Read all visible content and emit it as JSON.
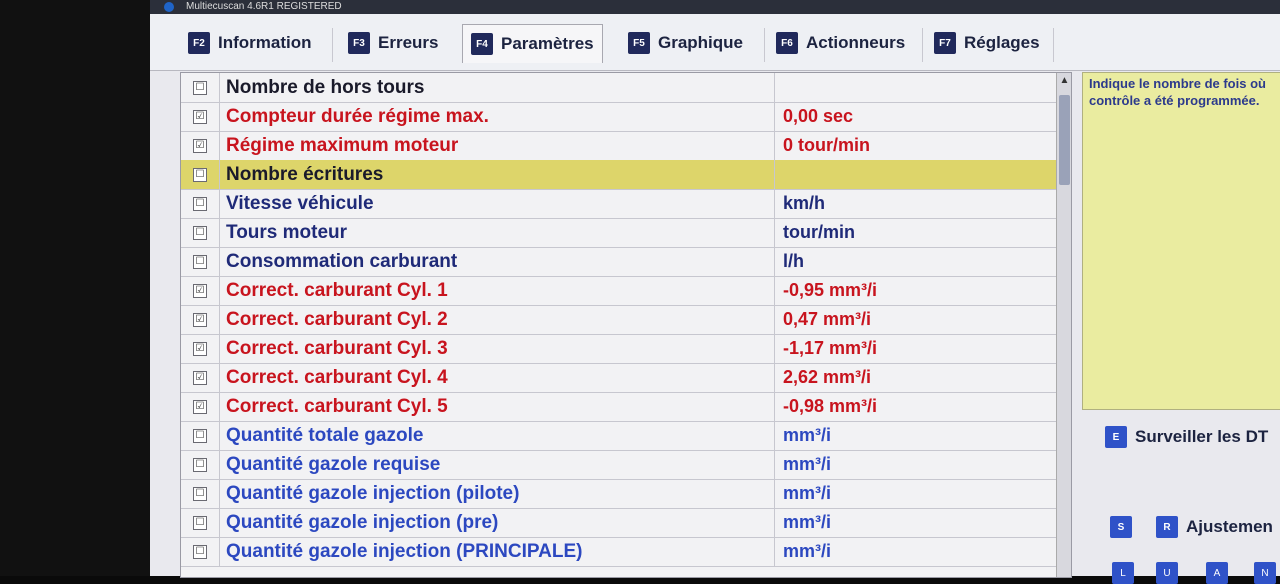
{
  "window": {
    "title": "Multiecuscan 4.6R1 REGISTERED"
  },
  "tabs": [
    {
      "key": "F2",
      "label": "Information"
    },
    {
      "key": "F3",
      "label": "Erreurs"
    },
    {
      "key": "F4",
      "label": "Paramètres"
    },
    {
      "key": "F5",
      "label": "Graphique"
    },
    {
      "key": "F6",
      "label": "Actionneurs"
    },
    {
      "key": "F7",
      "label": "Réglages"
    }
  ],
  "parameters": [
    {
      "checked": "☐",
      "name": "Nombre de hors tours",
      "value": ""
    },
    {
      "checked": "☑",
      "name": "Compteur durée régime max.",
      "value": "0,00 sec"
    },
    {
      "checked": "☑",
      "name": "Régime maximum moteur",
      "value": "0 tour/min"
    },
    {
      "checked": "☐",
      "name": "Nombre écritures",
      "value": ""
    },
    {
      "checked": "☐",
      "name": "Vitesse véhicule",
      "value": "km/h"
    },
    {
      "checked": "☐",
      "name": "Tours moteur",
      "value": "tour/min"
    },
    {
      "checked": "☐",
      "name": "Consommation carburant",
      "value": "l/h"
    },
    {
      "checked": "☑",
      "name": "Correct. carburant Cyl. 1",
      "value": "-0,95 mm³/i"
    },
    {
      "checked": "☑",
      "name": "Correct. carburant Cyl. 2",
      "value": "0,47 mm³/i"
    },
    {
      "checked": "☑",
      "name": "Correct. carburant Cyl. 3",
      "value": "-1,17 mm³/i"
    },
    {
      "checked": "☑",
      "name": "Correct. carburant Cyl. 4",
      "value": "2,62 mm³/i"
    },
    {
      "checked": "☑",
      "name": "Correct. carburant Cyl. 5",
      "value": "-0,98 mm³/i"
    },
    {
      "checked": "☐",
      "name": "Quantité totale gazole",
      "value": "mm³/i"
    },
    {
      "checked": "☐",
      "name": "Quantité gazole requise",
      "value": "mm³/i"
    },
    {
      "checked": "☐",
      "name": "Quantité gazole injection (pilote)",
      "value": "mm³/i"
    },
    {
      "checked": "☐",
      "name": "Quantité gazole injection (pre)",
      "value": "mm³/i"
    },
    {
      "checked": "☐",
      "name": "Quantité gazole injection (PRINCIPALE)",
      "value": "mm³/i"
    }
  ],
  "info_panel": {
    "text": "Indique le nombre de fois où contrôle a été programmée."
  },
  "buttons": {
    "monitor": {
      "key": "E",
      "label": "Surveiller les DT"
    },
    "adjust_s_key": "S",
    "adjust": {
      "key": "R",
      "label": "Ajustemen"
    }
  },
  "bottom_keys": [
    "L",
    "U",
    "A",
    "N"
  ],
  "scroll_up_glyph": "▲"
}
